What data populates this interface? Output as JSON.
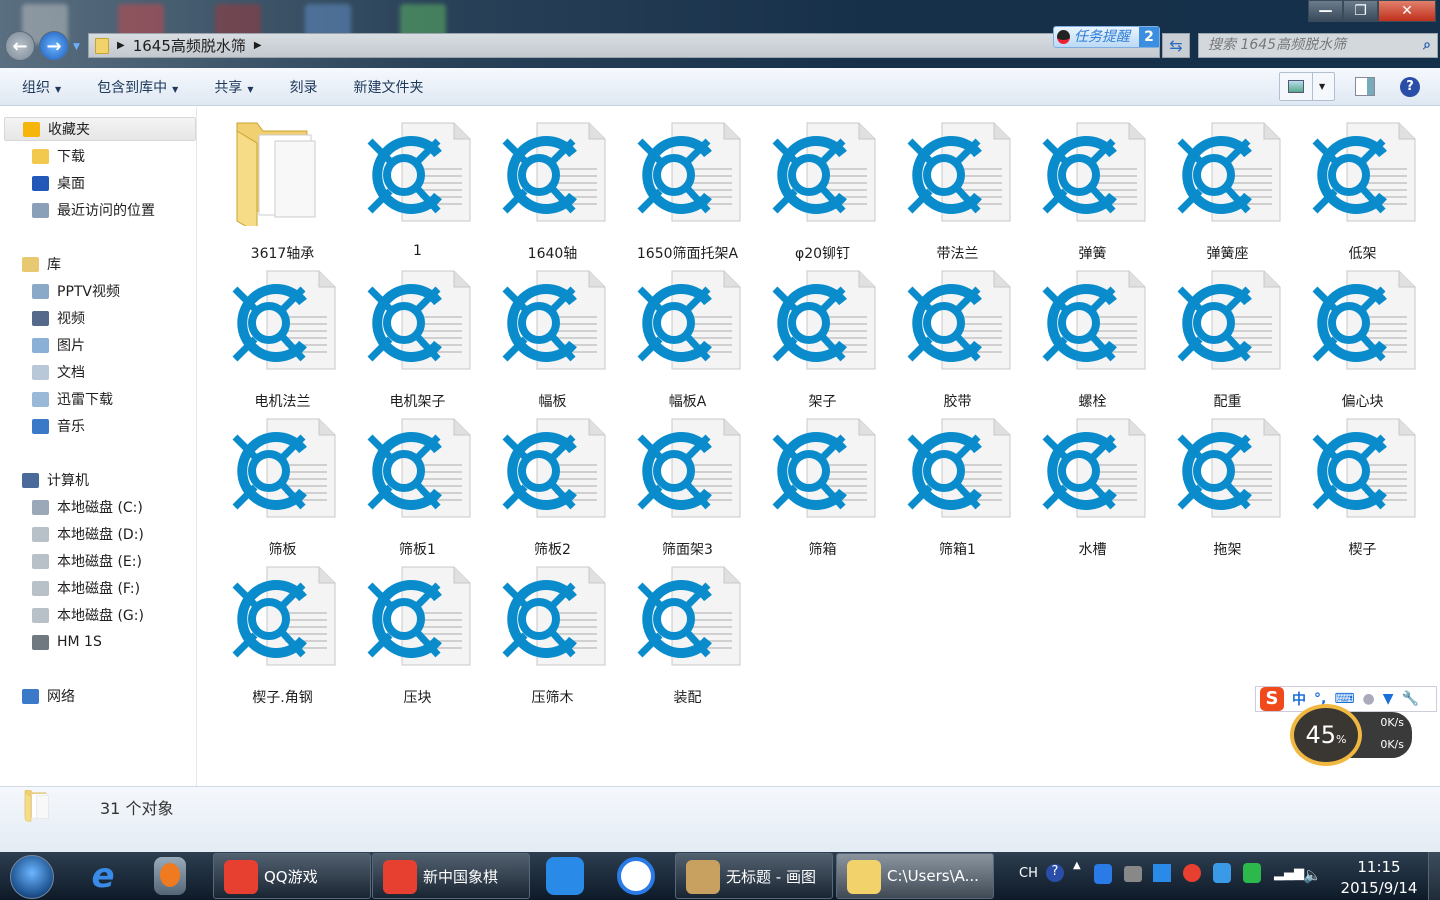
{
  "window": {
    "breadcrumb": "1645高频脱水筛",
    "search_placeholder": "搜索 1645高频脱水筛",
    "task_reminder": "任务提醒",
    "task_reminder_count": "2",
    "minimize": "—",
    "maximize": "❐",
    "close": "✕",
    "back": "←",
    "forward": "→"
  },
  "toolbar": {
    "organize": "组织",
    "include_library": "包含到库中",
    "share": "共享",
    "burn": "刻录",
    "new_folder": "新建文件夹",
    "help": "?"
  },
  "sidebar": [
    {
      "label": "收藏夹",
      "group": true,
      "color": "#f5b50a",
      "sel": true
    },
    {
      "label": "下载",
      "color": "#f2c94c"
    },
    {
      "label": "桌面",
      "color": "#2458b8"
    },
    {
      "label": "最近访问的位置",
      "color": "#8aa0b8"
    },
    {
      "label": "库",
      "group": true,
      "color": "#e8c870"
    },
    {
      "label": "PPTV视频",
      "color": "#8aa8c8"
    },
    {
      "label": "视频",
      "color": "#556a8a"
    },
    {
      "label": "图片",
      "color": "#8ab0d8"
    },
    {
      "label": "文档",
      "color": "#b8c8d8"
    },
    {
      "label": "迅雷下载",
      "color": "#9ab8d8"
    },
    {
      "label": "音乐",
      "color": "#3a78c8"
    },
    {
      "label": "计算机",
      "group": true,
      "color": "#4a6a9a"
    },
    {
      "label": "本地磁盘 (C:)",
      "color": "#9aa8b8"
    },
    {
      "label": "本地磁盘 (D:)",
      "color": "#b8c0c8"
    },
    {
      "label": "本地磁盘 (E:)",
      "color": "#b8c0c8"
    },
    {
      "label": "本地磁盘 (F:)",
      "color": "#b8c0c8"
    },
    {
      "label": "本地磁盘 (G:)",
      "color": "#b8c0c8"
    },
    {
      "label": "HM 1S",
      "color": "#707880"
    },
    {
      "label": "网络",
      "group": true,
      "color": "#3a7ac8"
    }
  ],
  "items": [
    {
      "name": "3617轴承",
      "type": "folder"
    },
    {
      "name": "1"
    },
    {
      "name": "1640轴"
    },
    {
      "name": "1650筛面托架A"
    },
    {
      "name": "φ20铆钉"
    },
    {
      "name": "带法兰"
    },
    {
      "name": "弹簧"
    },
    {
      "name": "弹簧座"
    },
    {
      "name": "低架"
    },
    {
      "name": "电机法兰"
    },
    {
      "name": "电机架子"
    },
    {
      "name": "幅板"
    },
    {
      "name": "幅板A"
    },
    {
      "name": "架子"
    },
    {
      "name": "胶带"
    },
    {
      "name": "螺栓"
    },
    {
      "name": "配重"
    },
    {
      "name": "偏心块"
    },
    {
      "name": "筛板"
    },
    {
      "name": "筛板1"
    },
    {
      "name": "筛板2"
    },
    {
      "name": "筛面架3"
    },
    {
      "name": "筛箱"
    },
    {
      "name": "筛箱1"
    },
    {
      "name": "水槽"
    },
    {
      "name": "拖架"
    },
    {
      "name": "楔子"
    },
    {
      "name": "楔子.角钢"
    },
    {
      "name": "压块"
    },
    {
      "name": "压筛木"
    },
    {
      "name": "装配"
    }
  ],
  "status": {
    "count": "31 个对象"
  },
  "taskbar": {
    "buttons": [
      {
        "label": "QQ游戏",
        "color": "#e84030"
      },
      {
        "label": "新中国象棋",
        "color": "#e84030"
      },
      {
        "label": "无标题 - 画图",
        "color": "#c8a060"
      },
      {
        "label": "C:\\Users\\A...",
        "color": "#f2d36b",
        "active": true
      }
    ],
    "tray_lang": "CH",
    "time": "11:15",
    "date": "2015/9/14"
  },
  "ime": {
    "logo": "S",
    "mode": "中"
  },
  "netmon": {
    "percent": "45",
    "unit": "%",
    "up": "0K/s",
    "down": "0K/s"
  }
}
